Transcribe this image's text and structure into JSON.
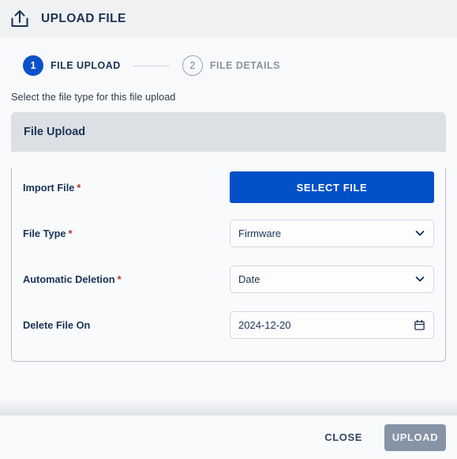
{
  "titlebar": {
    "icon": "upload-icon",
    "title": "UPLOAD FILE"
  },
  "stepper": {
    "steps": [
      {
        "number": "1",
        "label": "FILE UPLOAD",
        "state": "active"
      },
      {
        "number": "2",
        "label": "FILE DETAILS",
        "state": "inactive"
      }
    ]
  },
  "body": {
    "description": "Select the file type for this file upload"
  },
  "card": {
    "header_title": "File Upload",
    "fields": [
      {
        "label": "Import File",
        "required": "*",
        "control": "button",
        "value": "SELECT FILE"
      },
      {
        "label": "File Type",
        "required": "*",
        "control": "select",
        "value": "Firmware",
        "icon": "chevron-down-icon"
      },
      {
        "label": "Automatic Deletion",
        "required": "*",
        "control": "select",
        "value": "Date",
        "icon": "chevron-down-icon"
      },
      {
        "label": "Delete File On",
        "required": "",
        "control": "date",
        "value": "2024-12-20",
        "icon": "calendar-icon"
      }
    ]
  },
  "footer": {
    "close_label": "CLOSE",
    "upload_label": "UPLOAD",
    "upload_disabled": true
  },
  "colors": {
    "accent_blue": "#0450c8",
    "step_blue": "#0a50c8",
    "required_red": "#b4352a",
    "title_navy": "#1b3356",
    "card_header_gray": "#dcdfe4",
    "disabled_gray": "#8794a6",
    "page_background": "#f8f9fb",
    "titlebar_background": "#f0f1f3"
  }
}
